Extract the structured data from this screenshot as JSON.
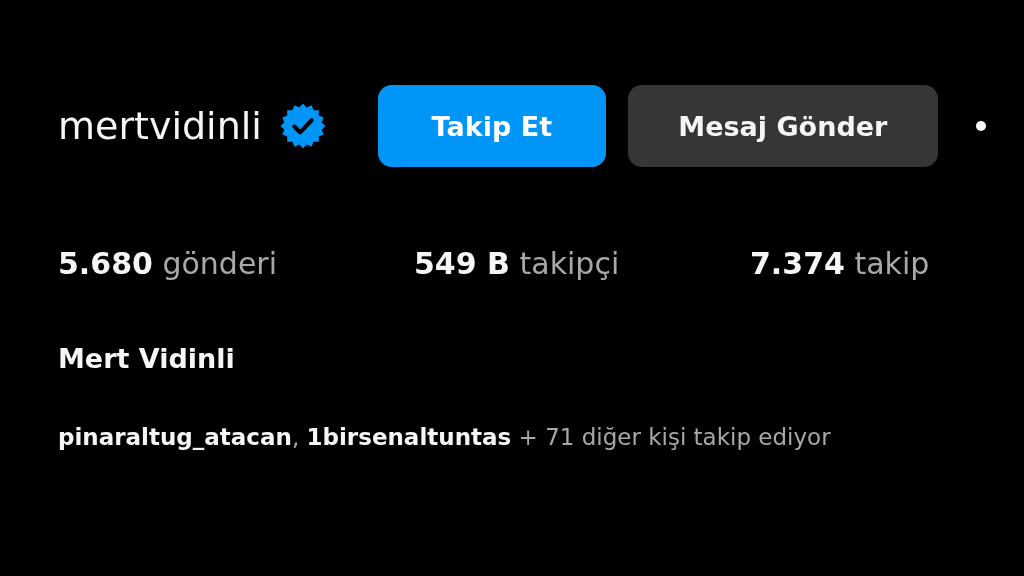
{
  "profile": {
    "username": "mertvidinli",
    "verified": true
  },
  "buttons": [
    {
      "label": "Takip Et",
      "kind": "primary"
    },
    {
      "label": "Mesaj Gönder",
      "kind": "secondary"
    }
  ],
  "stats": [
    {
      "count": "5.680",
      "label": "gönderi"
    },
    {
      "count": "549 B",
      "label": "takipçi"
    },
    {
      "count": "7.374",
      "label": "takip"
    }
  ],
  "full_name": "Mert Vidinli",
  "followed_by": "**pinaraltug_atacan**, **1birsenaltuntas** + 71 diğer kişi takip ediyor"
}
